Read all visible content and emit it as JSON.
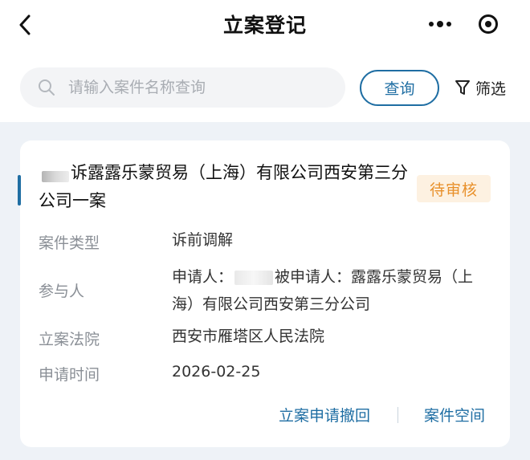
{
  "header": {
    "title": "立案登记",
    "back_icon": "chevron-left-icon",
    "more_icon": "more-dots-icon",
    "close_icon": "target-circle-icon"
  },
  "search": {
    "placeholder": "请输入案件名称查询",
    "query_label": "查询",
    "filter_label": "筛选"
  },
  "case": {
    "title": "诉露露乐蒙贸易（上海）有限公司西安第三分公司一案",
    "status": "待审核",
    "fields": {
      "type_label": "案件类型",
      "type_value": "诉前调解",
      "parties_label": "参与人",
      "applicant_prefix": "申请人：",
      "respondent_prefix": "被申请人：露露乐蒙贸易（上海）有限公司西安第三分公司",
      "court_label": "立案法院",
      "court_value": "西安市雁塔区人民法院",
      "date_label": "申请时间",
      "date_value": "2026-02-25"
    },
    "actions": {
      "withdraw": "立案申请撤回",
      "space": "案件空间"
    }
  },
  "colors": {
    "accent": "#1f6ea3",
    "status_text": "#e8902a",
    "status_bg": "#fdf1e1",
    "page_bg": "#eef2f7"
  }
}
